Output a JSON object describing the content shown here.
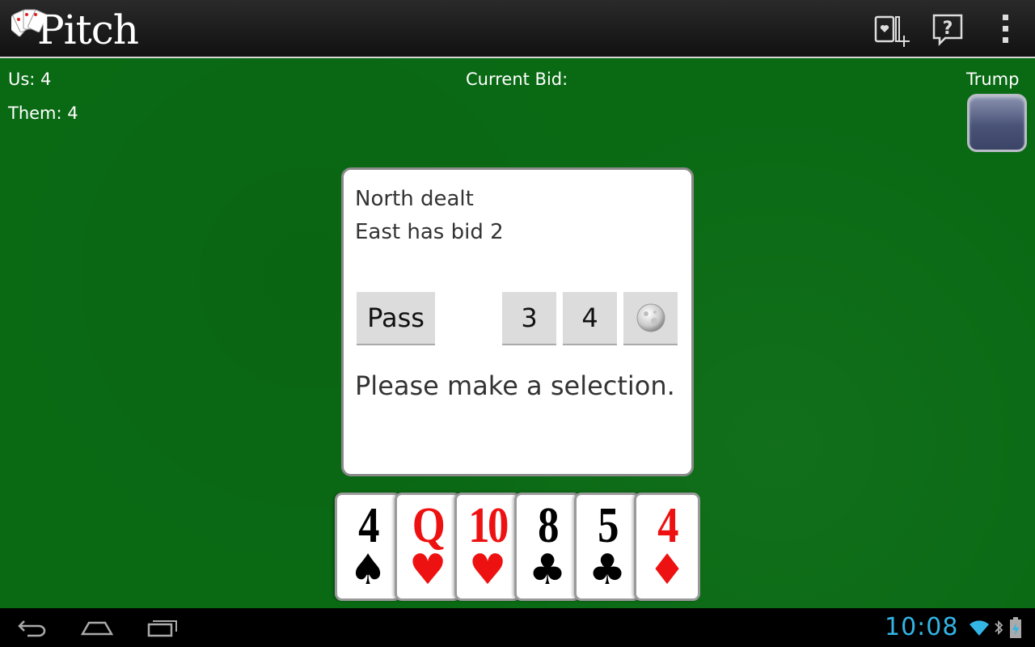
{
  "app": {
    "title": "Pitch"
  },
  "action_bar": {
    "icons": [
      "new-deal-icon",
      "help-icon",
      "overflow-menu-icon"
    ]
  },
  "scores": {
    "us_label": "Us: 4",
    "them_label": "Them: 4"
  },
  "bid": {
    "current_bid_label": "Current Bid:"
  },
  "trump": {
    "label": "Trump"
  },
  "dialog": {
    "messages": [
      "North dealt",
      "East has bid 2"
    ],
    "buttons": {
      "pass": "Pass",
      "bid_3": "3",
      "bid_4": "4",
      "shoot_moon_icon": "moon-icon"
    },
    "prompt": "Please make a selection."
  },
  "hand": [
    {
      "rank": "4",
      "suit": "♠",
      "suit_name": "spades",
      "color": "#000000"
    },
    {
      "rank": "Q",
      "suit": "♥",
      "suit_name": "hearts",
      "color": "#ee1111"
    },
    {
      "rank": "10",
      "suit": "♥",
      "suit_name": "hearts",
      "color": "#ee1111"
    },
    {
      "rank": "8",
      "suit": "♣",
      "suit_name": "clubs",
      "color": "#000000"
    },
    {
      "rank": "5",
      "suit": "♣",
      "suit_name": "clubs",
      "color": "#000000"
    },
    {
      "rank": "4",
      "suit": "♦",
      "suit_name": "diamonds",
      "color": "#ee1111"
    }
  ],
  "system_bar": {
    "time": "10:08",
    "icons": [
      "back-icon",
      "home-icon",
      "recent-apps-icon",
      "wifi-icon",
      "bluetooth-icon",
      "battery-icon"
    ]
  },
  "colors": {
    "felt": "#0a6a14",
    "clock": "#33b5e5"
  }
}
